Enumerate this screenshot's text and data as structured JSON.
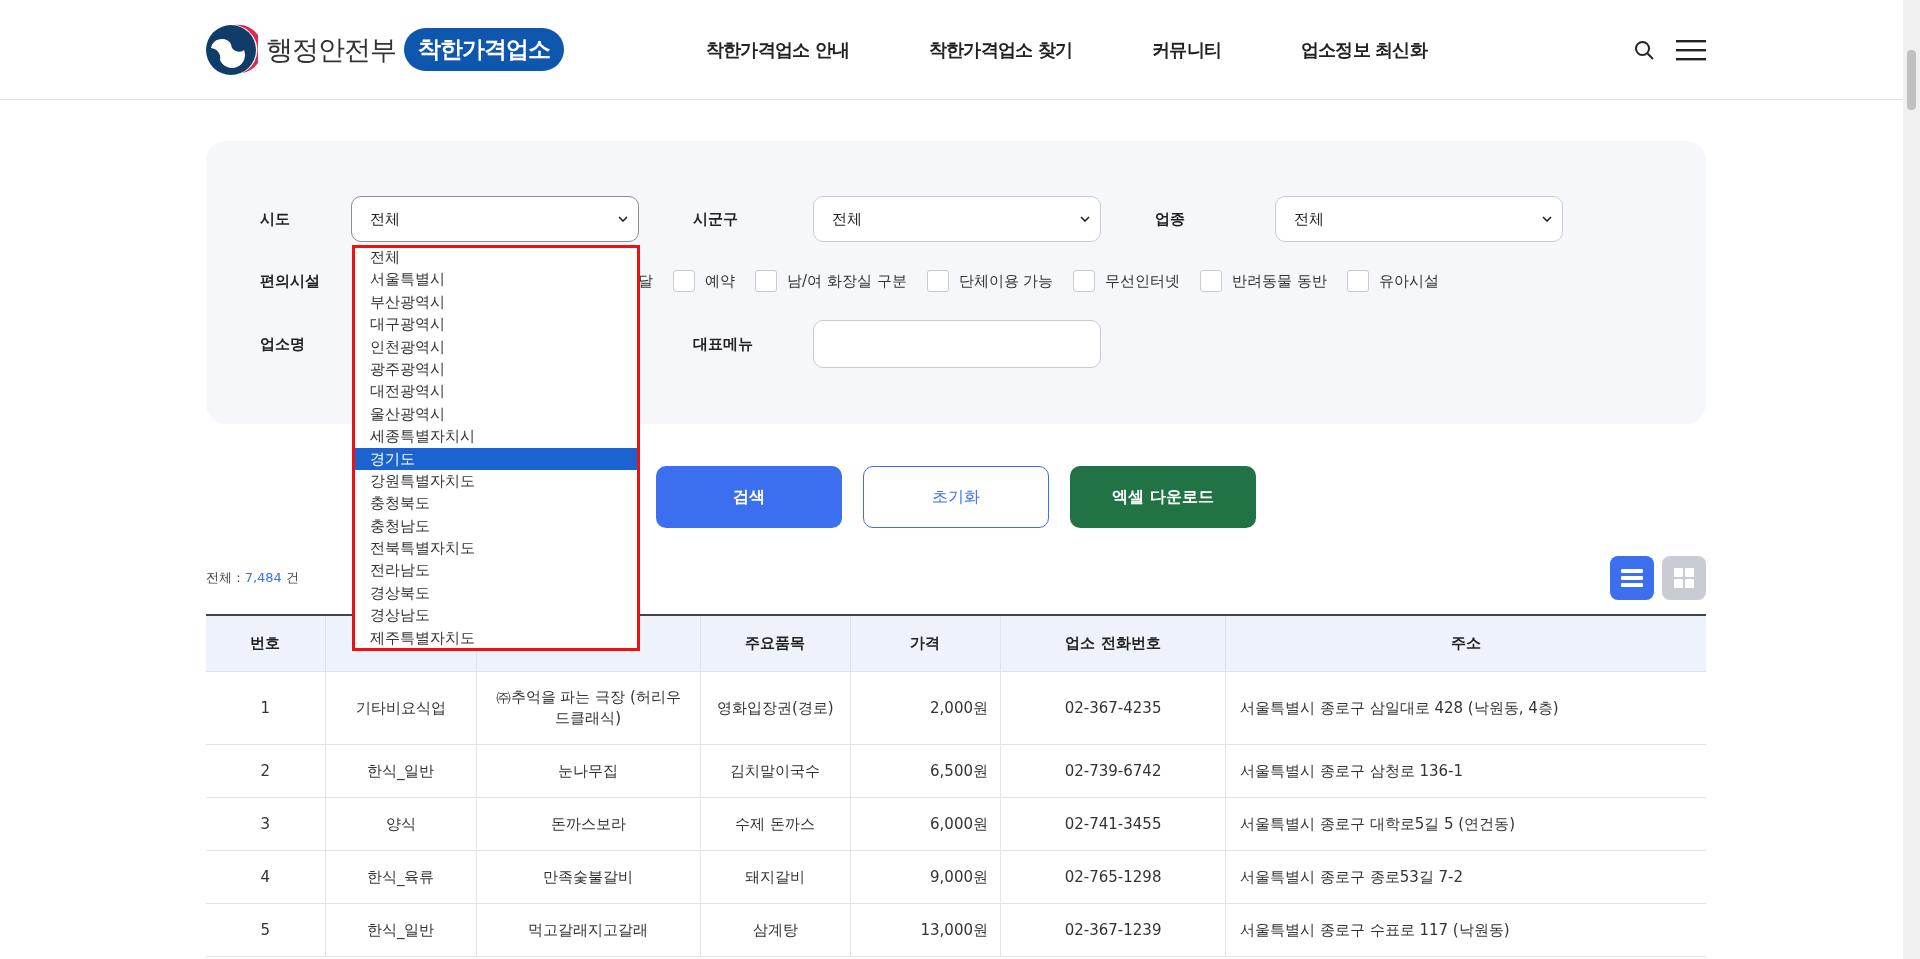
{
  "header": {
    "ministry": "행정안전부",
    "brand": "착한가격업소",
    "nav": [
      {
        "label": "착한가격업소 안내"
      },
      {
        "label": "착한가격업소 찾기"
      },
      {
        "label": "커뮤니티"
      },
      {
        "label": "업소정보 최신화"
      }
    ]
  },
  "filters": {
    "sido": {
      "label": "시도",
      "value": "전체",
      "expanded": true
    },
    "sigungu": {
      "label": "시군구",
      "value": "전체"
    },
    "category": {
      "label": "업종",
      "value": "전체"
    },
    "facilities": {
      "label": "편의시설",
      "items": [
        {
          "label": "달",
          "kind": "text_only"
        },
        {
          "label": "예약",
          "kind": "checkbox",
          "checked": false
        },
        {
          "label": "남/여 화장실 구분",
          "kind": "checkbox",
          "checked": false
        },
        {
          "label": "단체이용 가능",
          "kind": "checkbox",
          "checked": false
        },
        {
          "label": "무선인터넷",
          "kind": "checkbox",
          "checked": false
        },
        {
          "label": "반려동물 동반",
          "kind": "checkbox",
          "checked": false
        },
        {
          "label": "유아시설",
          "kind": "checkbox",
          "checked": false
        }
      ]
    },
    "name_label": "업소명",
    "menu": {
      "label": "대표메뉴"
    }
  },
  "dropdown": {
    "options": [
      {
        "label": "전체",
        "selected": false
      },
      {
        "label": "서울특별시",
        "selected": false
      },
      {
        "label": "부산광역시",
        "selected": false
      },
      {
        "label": "대구광역시",
        "selected": false
      },
      {
        "label": "인천광역시",
        "selected": false
      },
      {
        "label": "광주광역시",
        "selected": false
      },
      {
        "label": "대전광역시",
        "selected": false
      },
      {
        "label": "울산광역시",
        "selected": false
      },
      {
        "label": "세종특별자치시",
        "selected": false
      },
      {
        "label": "경기도",
        "selected": true
      },
      {
        "label": "강원특별자치도",
        "selected": false
      },
      {
        "label": "충청북도",
        "selected": false
      },
      {
        "label": "충청남도",
        "selected": false
      },
      {
        "label": "전북특별자치도",
        "selected": false
      },
      {
        "label": "전라남도",
        "selected": false
      },
      {
        "label": "경상북도",
        "selected": false
      },
      {
        "label": "경상남도",
        "selected": false
      },
      {
        "label": "제주특별자치도",
        "selected": false
      }
    ]
  },
  "buttons": [
    {
      "label": "검색",
      "kind": "primary"
    },
    {
      "label": "초기화",
      "kind": "outline"
    },
    {
      "label": "엑셀 다운로드",
      "kind": "excel"
    }
  ],
  "count": {
    "prefix": "전체 : ",
    "value": "7,484",
    "suffix": " 건"
  },
  "view": {
    "list_selected": true
  },
  "table": {
    "columns": [
      "번호",
      "",
      "",
      "주요품목",
      "가격",
      "업소 전화번호",
      "주소"
    ],
    "rows": [
      [
        "1",
        "기타비요식업",
        "㈜추억을 파는 극장 (허리우드클래식)",
        "영화입장권(경로)",
        "2,000원",
        "02-367-4235",
        "서울특별시 종로구 삼일대로 428 (낙원동, 4층)"
      ],
      [
        "2",
        "한식_일반",
        "눈나무집",
        "김치말이국수",
        "6,500원",
        "02-739-6742",
        "서울특별시 종로구 삼청로 136-1"
      ],
      [
        "3",
        "양식",
        "돈까스보라",
        "수제 돈까스",
        "6,000원",
        "02-741-3455",
        "서울특별시 종로구 대학로5길 5 (연건동)"
      ],
      [
        "4",
        "한식_육류",
        "만족숯불갈비",
        "돼지갈비",
        "9,000원",
        "02-765-1298",
        "서울특별시 종로구 종로53길 7-2"
      ],
      [
        "5",
        "한식_일반",
        "먹고갈래지고갈래",
        "삼계탕",
        "13,000원",
        "02-367-1239",
        "서울특별시 종로구 수표로 117 (낙원동)"
      ]
    ]
  }
}
